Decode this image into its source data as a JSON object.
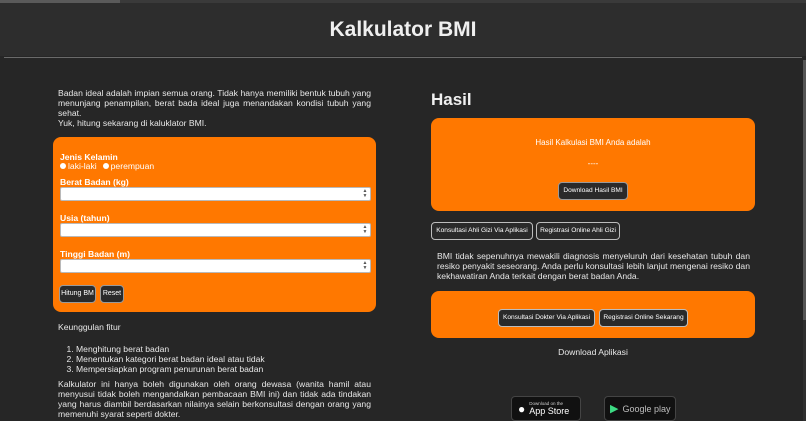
{
  "page": {
    "title": "Kalkulator BMI"
  },
  "intro": {
    "text": "Badan ideal adalah impian semua orang. Tidak hanya memiliki bentuk tubuh yang menunjang penampilan, berat bada ideal juga menandakan kondisi tubuh yang sehat.",
    "cta": "Yuk, hitung sekarang di kaluklator BMI."
  },
  "form": {
    "gender_label": "Jenis Kelamin",
    "gender_options": [
      "laki-laki",
      "perempuan"
    ],
    "weight_label": "Berat Badan (kg)",
    "age_label": "Usia (tahun)",
    "height_label": "Tinggi Badan (m)",
    "calc_button": "Hitung BM",
    "reset_button": "Reset"
  },
  "features": {
    "title": "Keunggulan fitur",
    "items": [
      "Menghitung berat badan",
      "Menentukan kategori berat badan ideal atau tidak",
      "Mempersiapkan program penurunan berat badan"
    ],
    "note": "Kalkulator ini hanya boleh digunakan oleh orang dewasa (wanita hamil atau menyusui tidak boleh mengandalkan pembacaan BMI ini) dan tidak ada tindakan yang harus diambil berdasarkan nilainya selain berkonsultasi dengan orang yang memenuhi syarat seperti dokter."
  },
  "result": {
    "heading": "Hasil",
    "label": "Hasil Kalkulasi BMI Anda adalah",
    "value": "----",
    "download_button": "Download Hasil BMI"
  },
  "links": {
    "consult_nutrition": "Konsultasi Ahli Gizi Via Aplikasi",
    "register_nutrition": "Registrasi Online Ahli Gizi"
  },
  "disclaimer": "BMI tidak sepenuhnya mewakili diagnosis menyeluruh dari kesehatan tubuh dan resiko penyakit seseorang. Anda perlu konsultasi lebih lanjut mengenai resiko dan kekhawatiran Anda terkait dengan berat badan Anda.",
  "consult": {
    "doctor_button": "Konsultasi Dokter Via Aplikasi",
    "register_button": "Registrasi Online Sekarang"
  },
  "download": {
    "label": "Download Aplikasi",
    "appstore_small": "Download on the",
    "appstore_big": "App Store",
    "googleplay_big": "Google play"
  },
  "colors": {
    "accent": "#ff7800",
    "background": "#262626",
    "button_dark": "#2a2a2a"
  }
}
